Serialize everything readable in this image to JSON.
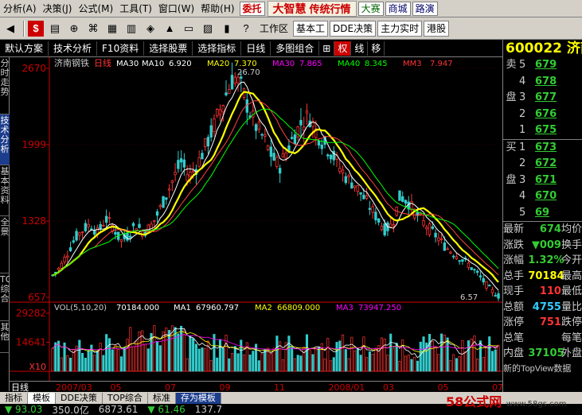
{
  "menu": {
    "items": [
      "分析(A)",
      "决策(J)",
      "公式(M)",
      "工具(T)",
      "窗口(W)",
      "帮助(H)"
    ],
    "entrust": "委托",
    "brand": "大智慧",
    "brand_sub": "传统行情",
    "right_buttons": [
      "大赛",
      "商城",
      "路演"
    ]
  },
  "toolbar": {
    "workspace_label": "工作区",
    "workspace_value": "基本工",
    "buttons": [
      "DDE决策",
      "主力实时",
      "港股"
    ]
  },
  "chart_toolbar": {
    "items": [
      "默认方案",
      "技术分析",
      "F10资料",
      "选择股票",
      "选择指标",
      "日线",
      "多图组合"
    ],
    "icons": [
      "十字",
      "权",
      "线",
      "移"
    ]
  },
  "left_tabs": [
    "分时走势",
    "技术分析",
    "基本资料",
    "全景",
    "TOP综合",
    "其他"
  ],
  "colors": {
    "up": "#ff3333",
    "down": "#33cccc",
    "ma10": "#ffffff",
    "ma20": "#ffff00",
    "ma30": "#ff00ff",
    "ma40": "#00ff00",
    "ma60": "#ff4444",
    "axis": "#cc0000",
    "bg": "#000000"
  },
  "chart_data": [
    {
      "type": "candlestick",
      "stock": "济南钢铁",
      "period": "日线",
      "indicator": "MA30",
      "ma_legend": [
        {
          "name": "MA10",
          "value": "6.920"
        },
        {
          "name": "MA20",
          "value": "7.370"
        },
        {
          "name": "MA30",
          "value": "7.865"
        },
        {
          "name": "MA40",
          "value": "8.345"
        },
        {
          "name": "MM3",
          "value": "7.947"
        }
      ],
      "y_ticks": [
        "2670",
        "1999",
        "1328",
        "657"
      ],
      "ylim": [
        6.57,
        26.7
      ],
      "high_label": "26.70",
      "low_label": "6.57",
      "x_ticks": [
        "2007/03",
        "05",
        "07",
        "09",
        "11",
        "2008/01",
        "03",
        "05",
        "07"
      ],
      "close_path": [
        8.5,
        9.2,
        10.5,
        11.8,
        12.5,
        13.0,
        12.2,
        13.5,
        12.8,
        11.5,
        12.0,
        13.0,
        12.3,
        12.8,
        14.0,
        15.5,
        17.0,
        18.5,
        17.2,
        18.0,
        19.5,
        21.0,
        22.8,
        24.5,
        26.0,
        25.0,
        23.0,
        21.5,
        20.5,
        19.0,
        18.0,
        19.5,
        20.8,
        22.0,
        22.5,
        21.0,
        20.0,
        19.2,
        18.0,
        17.0,
        16.5,
        15.5,
        14.5,
        13.5,
        12.5,
        13.0,
        15.5,
        15.0,
        14.0,
        13.2,
        12.5,
        11.8,
        11.0,
        10.5,
        10.0,
        9.5,
        8.8,
        8.0,
        7.2,
        6.7
      ]
    },
    {
      "type": "bar",
      "indicator": "VOL(5,10,20)",
      "value": "70184.000",
      "ma_legend": [
        {
          "name": "MA1",
          "value": "67960.797"
        },
        {
          "name": "MA2",
          "value": "66809.000"
        },
        {
          "name": "MA3",
          "value": "73947.250"
        }
      ],
      "y_ticks": [
        "29282",
        "14641",
        "X10"
      ],
      "ylim": [
        0,
        29282
      ]
    }
  ],
  "rightpanel": {
    "code": "600022",
    "name": "济南",
    "sell_label_top": "卖",
    "sell_label_bottom": "盘",
    "buy_label_top": "买",
    "buy_label_bottom": "盘",
    "sell": [
      {
        "level": "5",
        "price": "679"
      },
      {
        "level": "4",
        "price": "678"
      },
      {
        "level": "3",
        "price": "677"
      },
      {
        "level": "2",
        "price": "676"
      },
      {
        "level": "1",
        "price": "675"
      }
    ],
    "buy": [
      {
        "level": "1",
        "price": "673"
      },
      {
        "level": "2",
        "price": "672"
      },
      {
        "level": "3",
        "price": "671"
      },
      {
        "level": "4",
        "price": "670"
      },
      {
        "level": "5",
        "price": "69"
      }
    ],
    "quotes": [
      {
        "label": "最新",
        "value": "674",
        "color": "#3c3",
        "tail": "均价"
      },
      {
        "label": "涨跌",
        "value": "▼009",
        "color": "#3c3",
        "tail": "换手"
      },
      {
        "label": "涨幅",
        "value": "1.32%",
        "color": "#3c3",
        "tail": "今开"
      },
      {
        "label": "总手",
        "value": "70184",
        "color": "#ff0",
        "tail": "最高"
      },
      {
        "label": "现手",
        "value": "110",
        "color": "#f33",
        "tail": "最低"
      },
      {
        "label": "总额",
        "value": "4755",
        "color": "#3cf",
        "tail": "量比"
      },
      {
        "label": "涨停",
        "value": "751",
        "color": "#f33",
        "tail": "跌停"
      },
      {
        "label": "总笔",
        "value": "",
        "color": "#fff",
        "tail": "每笔"
      },
      {
        "label": "内盘",
        "value": "37105",
        "color": "#3c3",
        "tail": "外盘"
      }
    ],
    "footer": "新的TopView数据"
  },
  "bottom_tabs": [
    "指标",
    "模板",
    "DDE决策",
    "TOP综合",
    "标准",
    "存为模板"
  ],
  "timeline_label": "日线",
  "statusbar": [
    {
      "text": "▼ 93.03",
      "color": "#3c3"
    },
    {
      "text": "350.0亿",
      "color": "#ccc"
    },
    {
      "text": "6873.61",
      "color": "#ccc"
    },
    {
      "text": "▼ 61.46",
      "color": "#3c3"
    },
    {
      "text": "137.7",
      "color": "#ccc"
    }
  ],
  "watermark": {
    "brand": "58公式网",
    "url": "www.58gs.com"
  }
}
